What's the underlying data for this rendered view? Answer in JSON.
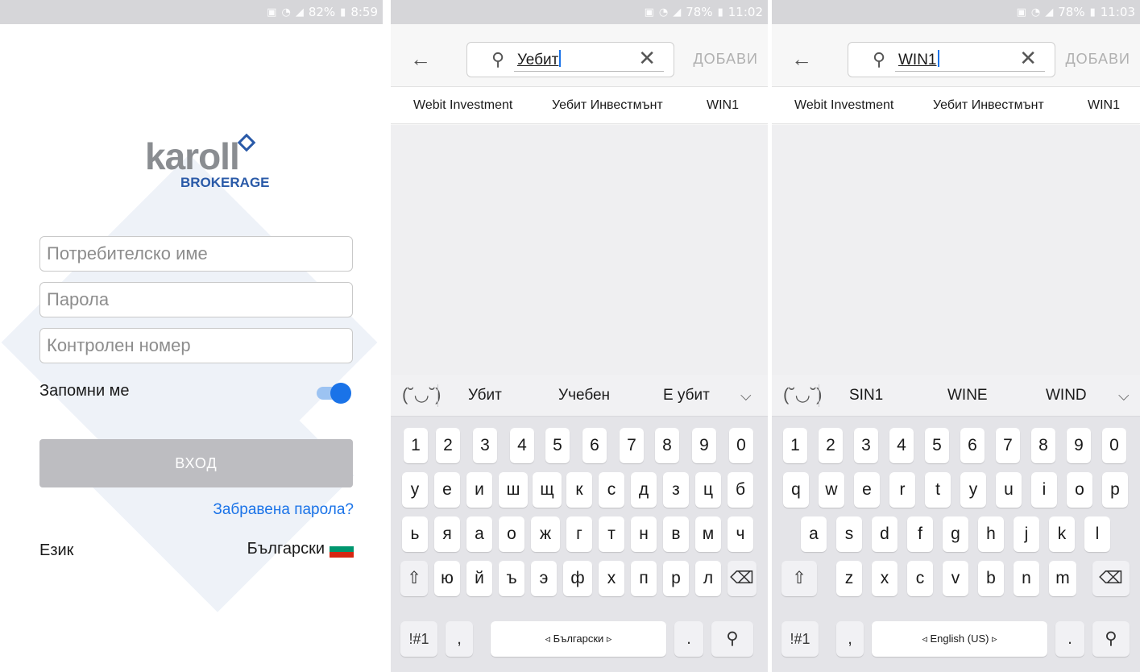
{
  "screen1": {
    "status": {
      "percent": "82%",
      "time": "8:59"
    },
    "logo": {
      "word": "karoll",
      "sub": "BROKERAGE"
    },
    "fields": {
      "username_placeholder": "Потребителско име",
      "password_placeholder": "Парола",
      "control_placeholder": "Контролен номер"
    },
    "remember_label": "Запомни ме",
    "remember_on": true,
    "login_label": "ВХОД",
    "forgot_label": "Забравена парола?",
    "language_label": "Език",
    "language_value": "Български",
    "colors": {
      "accent": "#1a73e8",
      "brand": "#2a5aa8",
      "disabled": "#bdbdc1"
    }
  },
  "screen2": {
    "status": {
      "percent": "78%",
      "time": "11:02"
    },
    "search_text": "Уебит",
    "add_label": "ДОБАВИ",
    "results": [
      "Webit Investment",
      "Уебит Инвестмънт",
      "WIN1"
    ],
    "suggestions": [
      "Убит",
      "Учебен",
      "Е убит"
    ],
    "keyboard": {
      "row1": [
        "1",
        "2",
        "3",
        "4",
        "5",
        "6",
        "7",
        "8",
        "9",
        "0"
      ],
      "row2": [
        "у",
        "е",
        "и",
        "ш",
        "щ",
        "к",
        "с",
        "д",
        "з",
        "ц",
        "б"
      ],
      "row3": [
        "ь",
        "я",
        "а",
        "о",
        "ж",
        "г",
        "т",
        "н",
        "в",
        "м",
        "ч"
      ],
      "row4": [
        "ю",
        "й",
        "ъ",
        "э",
        "ф",
        "х",
        "п",
        "р",
        "л"
      ],
      "sym": "!#1",
      "comma": ",",
      "space": "◃ Български ▹",
      "period": "."
    }
  },
  "screen3": {
    "status": {
      "percent": "78%",
      "time": "11:03"
    },
    "search_text": "WIN1",
    "add_label": "ДОБАВИ",
    "results": [
      "Webit Investment",
      "Уебит Инвестмънт",
      "WIN1"
    ],
    "suggestions": [
      "SIN1",
      "WINE",
      "WIND"
    ],
    "keyboard": {
      "row1": [
        "1",
        "2",
        "3",
        "4",
        "5",
        "6",
        "7",
        "8",
        "9",
        "0"
      ],
      "row2": [
        "q",
        "w",
        "e",
        "r",
        "t",
        "y",
        "u",
        "i",
        "o",
        "p"
      ],
      "row3": [
        "a",
        "s",
        "d",
        "f",
        "g",
        "h",
        "j",
        "k",
        "l"
      ],
      "row4": [
        "z",
        "x",
        "c",
        "v",
        "b",
        "n",
        "m"
      ],
      "sym": "!#1",
      "comma": ",",
      "space": "◃ English (US) ▹",
      "period": "."
    }
  },
  "icons": {
    "back": "arrow-left-icon",
    "search": "magnifier-icon",
    "clear": "close-icon",
    "emoji": "emoji-icon",
    "expand": "chevron-down-icon",
    "shift": "shift-icon",
    "backspace": "backspace-icon"
  }
}
